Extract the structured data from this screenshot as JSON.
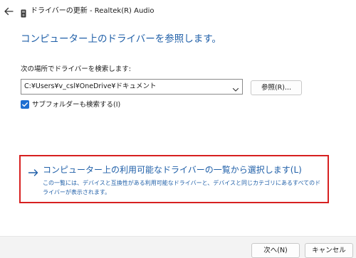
{
  "window": {
    "title": "ドライバーの更新 - Realtek(R) Audio"
  },
  "icons": {
    "back": "back-arrow-icon",
    "device": "audio-device-icon",
    "combo": "chevron-down-icon",
    "checkbox": "checkmark-icon",
    "option": "right-arrow-icon"
  },
  "main": {
    "heading": "コンピューター上のドライバーを参照します。",
    "location_label": "次の場所でドライバーを検索します:",
    "path_value": "C:¥Users¥v_csl¥OneDrive¥ドキュメント",
    "browse_label": "参照(R)...",
    "subfolder_label": "サブフォルダーも検索する(I)",
    "subfolder_checked": true
  },
  "option": {
    "title": "→ コンピューター上の利用可能なドライバーの一覧から選択します(L)",
    "title_text": "コンピューター上の利用可能なドライバーの一覧から選択します(L)",
    "description": "この一覧には、デバイスと互換性がある利用可能なドライバーと、デバイスと同じカテゴリにあるすべてのドライバーが表示されます。"
  },
  "footer": {
    "next_label": "次へ(N)",
    "cancel_label": "キャンセル"
  },
  "colors": {
    "accent_blue": "#1f5fa8",
    "highlight_red": "#d72020",
    "checkbox_blue": "#1f6fd1",
    "footer_bg": "#f3f3f3"
  }
}
